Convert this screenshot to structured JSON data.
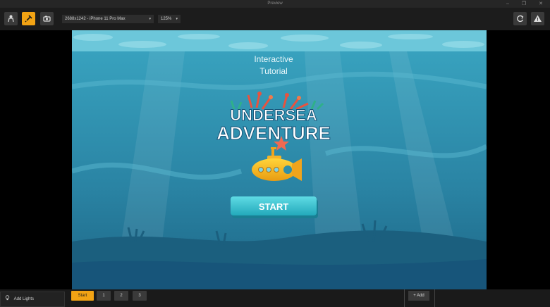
{
  "window": {
    "title": "Preview",
    "minimize_glyph": "–",
    "maximize_glyph": "❐",
    "close_glyph": "✕"
  },
  "toolbar": {
    "device_select": "2688x1242 - iPhone 11 Pro Max",
    "zoom_select": "125%",
    "caret": "▾",
    "icons": {
      "left1": "person-icon",
      "left2": "pin-icon",
      "left3": "camera-icon",
      "right1": "refresh-icon",
      "right2": "warning-icon"
    }
  },
  "game": {
    "subtitle_line1": "Interactive",
    "subtitle_line2": "Tutorial",
    "title_line1": "UNDERSEA",
    "title_line2": "ADVENTURE",
    "start_label": "START"
  },
  "bottom": {
    "add_lights_label": "Add Lights",
    "tabs": [
      "Start",
      "1",
      "2",
      "3"
    ],
    "add_label": "+ Add"
  },
  "colors": {
    "accent": "#f2a314",
    "water": "#2c8aa8",
    "button": "#35c1cf"
  }
}
